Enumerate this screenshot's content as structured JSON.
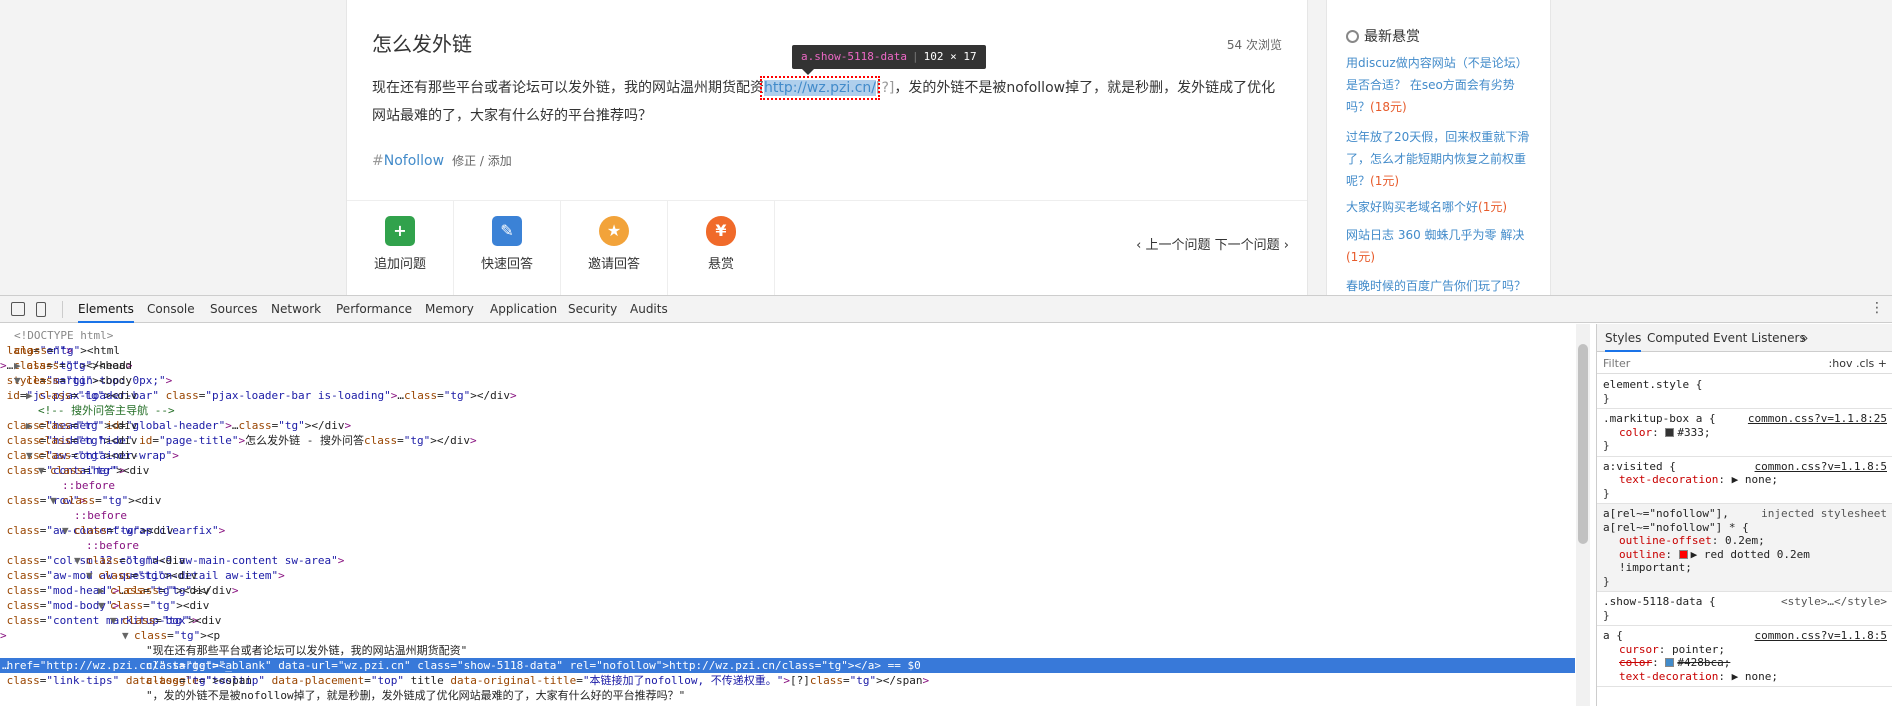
{
  "page": {
    "question": {
      "title": "怎么发外链",
      "views": "54 次浏览",
      "body_before": "现在还有那些平台或者论坛可以发外链，我的网站温州期货配资",
      "link_text": "http://wz.pzi.cn/",
      "link_tips": "[?]",
      "body_after": "，发的外链不是被nofollow掉了，就是秒删，发外链成了优化网站最难的了，大家有什么好的平台推荐吗？",
      "tooltip_selector": "a.show-5118-data",
      "tooltip_size": "102 × 17",
      "tag_hash": "#",
      "tag": "Nofollow",
      "tag_edit": "修正 / 添加"
    },
    "actions": [
      {
        "label": "追加问题",
        "icon": "add-question-icon"
      },
      {
        "label": "快速回答",
        "icon": "quick-answer-icon"
      },
      {
        "label": "邀请回答",
        "icon": "invite-answer-icon"
      },
      {
        "label": "悬赏",
        "icon": "bounty-bag-icon"
      }
    ],
    "nav": {
      "prev": "上一个问题",
      "next": "下一个问题"
    },
    "sidebar": {
      "title": "最新悬赏",
      "items": [
        {
          "text": "用discuz做内容网站（不是论坛）是否合适？ 在seo方面会有劣势吗？",
          "amount": "(18元)"
        },
        {
          "text": "过年放了20天假，回来权重就下滑了，怎么才能短期内恢复之前权重呢？",
          "amount": "(1元)"
        },
        {
          "text": "大家好购买老域名哪个好",
          "amount": "(1元)"
        },
        {
          "text": "网站日志 360 蜘蛛几乎为零 解决",
          "amount": "(1元)"
        },
        {
          "text": "春晚时候的百度广告你们玩了吗？",
          "amount": ""
        }
      ]
    }
  },
  "devtools": {
    "tabs": [
      "Elements",
      "Console",
      "Sources",
      "Network",
      "Performance",
      "Memory",
      "Application",
      "Security",
      "Audits"
    ],
    "active_tab": "Elements",
    "dom_lines": [
      {
        "indent": 0,
        "arrow": "",
        "tag": "<!DOCTYPE html>",
        "kind": "doctype"
      },
      {
        "indent": 0,
        "arrow": "",
        "tag": "<html lang=\"en\">",
        "kind": "tag"
      },
      {
        "indent": 1,
        "arrow": "▶",
        "tag": "<head>…</head>",
        "kind": "tag"
      },
      {
        "indent": 1,
        "arrow": "▼",
        "tag": "<body style=\"margin-top: 0px;\">",
        "kind": "tag"
      },
      {
        "indent": 2,
        "arrow": "▶",
        "tag": "<div id=\"js-pjax-loader-bar\" class=\"pjax-loader-bar is-loading\">…</div>",
        "kind": "tag"
      },
      {
        "indent": 2,
        "arrow": "",
        "tag": "<!-- 搜外问答主导航 -->",
        "kind": "comment"
      },
      {
        "indent": 2,
        "arrow": "▶",
        "tag": "<div class=\"header\" id=\"global-header\">…</div>",
        "kind": "tag"
      },
      {
        "indent": 2,
        "arrow": "",
        "tag": "<div class=\"hidden hide\" id=\"page-title\">怎么发外链 - 搜外问答</div>",
        "kind": "tag"
      },
      {
        "indent": 2,
        "arrow": "▼",
        "tag": "<div class=\"aw-container-wrap\">",
        "kind": "tag"
      },
      {
        "indent": 3,
        "arrow": "▼",
        "tag": "<div class=\"container\">",
        "kind": "tag"
      },
      {
        "indent": 4,
        "arrow": "",
        "tag": "::before",
        "kind": "pseudo"
      },
      {
        "indent": 4,
        "arrow": "▼",
        "tag": "<div class=\"row\">",
        "kind": "tag"
      },
      {
        "indent": 5,
        "arrow": "",
        "tag": "::before",
        "kind": "pseudo"
      },
      {
        "indent": 5,
        "arrow": "▼",
        "tag": "<div class=\"aw-content-wrap clearfix\">",
        "kind": "tag"
      },
      {
        "indent": 6,
        "arrow": "",
        "tag": "::before",
        "kind": "pseudo"
      },
      {
        "indent": 6,
        "arrow": "▼",
        "tag": "<div class=\"col-sm-12 col-md-9 aw-main-content sw-area\">",
        "kind": "tag"
      },
      {
        "indent": 7,
        "arrow": "▼",
        "tag": "<div class=\"aw-mod aw-question-detail aw-item\">",
        "kind": "tag"
      },
      {
        "indent": 8,
        "arrow": "▶",
        "tag": "<div class=\"mod-head\">…</div>",
        "kind": "tag"
      },
      {
        "indent": 8,
        "arrow": "▼",
        "tag": "<div class=\"mod-body\">",
        "kind": "tag"
      },
      {
        "indent": 9,
        "arrow": "▼",
        "tag": "<div class=\"content markitup-box\">",
        "kind": "tag"
      },
      {
        "indent": 10,
        "arrow": "▼",
        "tag": "<p>",
        "kind": "tag"
      },
      {
        "indent": 11,
        "arrow": "",
        "tag": "\"现在还有那些平台或者论坛可以发外链，我的网站温州期货配资\"",
        "kind": "text"
      },
      {
        "indent": 11,
        "arrow": "",
        "tag": "<a href=\"http://wz.pzi.cn/\" target=\"_blank\" data-url=\"wz.pzi.cn\" class=\"show-5118-data\" rel=\"nofollow\">http://wz.pzi.cn/</a> == $0",
        "kind": "selected"
      },
      {
        "indent": 11,
        "arrow": "",
        "tag": "<span class=\"link-tips\" data-toggle=\"tooltip\" data-placement=\"top\" title data-original-title=\"本链接加了nofollow, 不传递权重。\">[?]</span>",
        "kind": "tag"
      },
      {
        "indent": 11,
        "arrow": "",
        "tag": "\"，发的外链不是被nofollow掉了，就是秒删，发外链成了优化网站最难的了，大家有什么好的平台推荐吗？\"",
        "kind": "text"
      }
    ],
    "styles": {
      "tabs": [
        "Styles",
        "Computed",
        "Event Listeners",
        "»"
      ],
      "filter_placeholder": "Filter",
      "filter_right": ":hov  .cls  +",
      "rules": [
        {
          "selector": "element.style {",
          "source": "",
          "decls": [],
          "close": "}"
        },
        {
          "selector": ".markitup-box a {",
          "source": "common.css?v=1.1.8:25",
          "decls": [
            {
              "name": "color",
              "value": "#333;",
              "swatch": "#333333"
            }
          ],
          "close": "}"
        },
        {
          "selector": "a:visited {",
          "source": "common.css?v=1.1.8:5",
          "decls": [
            {
              "name": "text-decoration",
              "value": "▶ none;"
            }
          ],
          "close": "}"
        },
        {
          "selector": "a[rel~=\"nofollow\"], a[rel~=\"nofollow\"] * {",
          "source": "injected stylesheet",
          "decls": [
            {
              "name": "outline-offset",
              "value": "0.2em;"
            },
            {
              "name": "outline",
              "value": "▶ red dotted 0.2em !important;",
              "swatch": "#ff0000"
            }
          ],
          "close": "}"
        },
        {
          "selector": ".show-5118-data {",
          "source": "<style>…</style>",
          "decls": [],
          "close": "}"
        },
        {
          "selector": "a {",
          "source": "common.css?v=1.1.8:5",
          "decls": [
            {
              "name": "cursor",
              "value": "pointer;"
            },
            {
              "name": "color",
              "value": "#428bca;",
              "swatch": "#428bca",
              "strike": true
            },
            {
              "name": "text-decoration",
              "value": "▶ none;"
            }
          ],
          "close": ""
        }
      ]
    }
  }
}
